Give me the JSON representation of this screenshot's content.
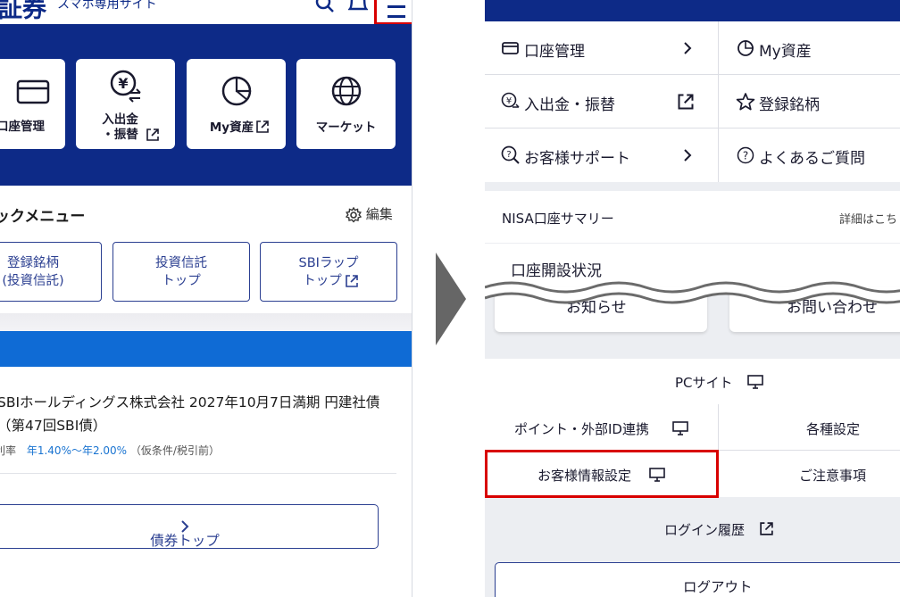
{
  "left": {
    "brand": "証券",
    "brand_sub": "スマホ専用サイト",
    "tiles": [
      {
        "label": "口座管理",
        "icon": "wallet-icon"
      },
      {
        "label_1": "入出金",
        "label_2": "・振替",
        "icon": "yen-exchange-icon"
      },
      {
        "label": "My資産",
        "icon": "pie-chart-icon"
      },
      {
        "label": "マーケット",
        "icon": "globe-icon"
      }
    ],
    "quick_menu": {
      "title": "ックメニュー",
      "edit": "編集",
      "buttons": [
        {
          "line1": "登録銘柄",
          "line2": "(投資信託)"
        },
        {
          "line1": "投資信託",
          "line2": "トップ"
        },
        {
          "line1": "SBIラップ",
          "line2": "トップ"
        }
      ]
    },
    "bond": {
      "title": "SBIホールディングス株式会社 2027年10月7日満期 円建社債（第47回SBI債）",
      "rate_label": "利率",
      "rate_value": "年1.40%～年2.00%",
      "rate_note": "（仮条件/税引前）",
      "button": "債券トップ"
    }
  },
  "right": {
    "grid": [
      {
        "label": "口座管理",
        "icon": "wallet-icon",
        "trail": "chevron-right-icon"
      },
      {
        "label": "My資産",
        "icon": "pie-chart-icon"
      },
      {
        "label": "入出金・振替",
        "icon": "yen-exchange-icon",
        "trail": "external-link-icon"
      },
      {
        "label": "登録銘柄",
        "icon": "star-icon"
      },
      {
        "label": "お客様サポート",
        "icon": "search-help-icon",
        "trail": "chevron-right-icon"
      },
      {
        "label": "よくあるご質問",
        "icon": "question-icon"
      }
    ],
    "nisa": {
      "title": "NISA口座サマリー",
      "detail": "詳細はこち"
    },
    "account_status": "口座開設状況",
    "cards": [
      "お知らせ",
      "お問い合わせ"
    ],
    "pc_site": "PCサイト",
    "settings": [
      {
        "label": "ポイント・外部ID連携"
      },
      {
        "label": "各種設定"
      },
      {
        "label": "お客様情報設定"
      },
      {
        "label": "ご注意事項"
      }
    ],
    "login_history": "ログイン履歴",
    "logout": "ログアウト"
  },
  "colors": {
    "navy": "#0d2a87",
    "accent_blue": "#0f6bd5",
    "highlight_red": "#d80000"
  }
}
